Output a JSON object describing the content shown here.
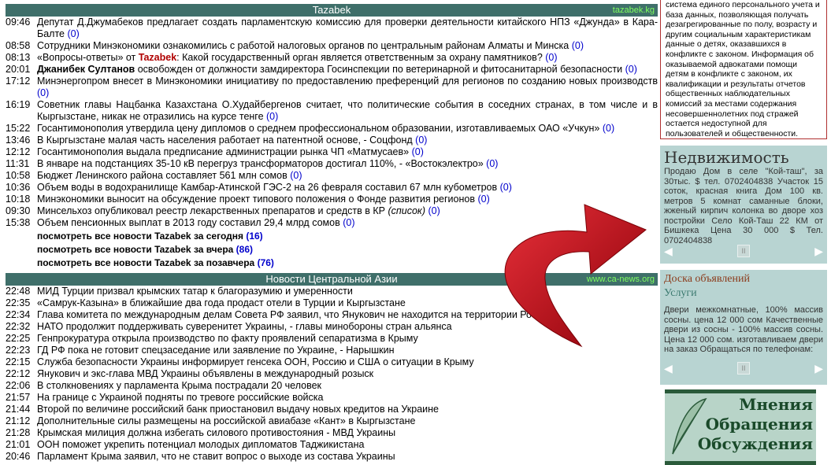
{
  "tazabek": {
    "title": "Tazabek",
    "site": "tazabek.kg",
    "news": [
      {
        "time": "09:46",
        "text": "Депутат Д.Джумабеков предлагает создать парламентскую комиссию для проверки деятельности китайского НПЗ «Джунда» в Кара-Балте",
        "count": "(0)"
      },
      {
        "time": "08:58",
        "text": "Сотрудники Минэкономики ознакомились с работой налоговых органов по центральным районам Алматы и Минска",
        "count": "(0)"
      },
      {
        "time": "08:13",
        "text": "«Вопросы-ответы» от ",
        "brand": "Tazabek",
        "after": ": Какой государственный орган является ответственным за охрану памятников?",
        "count": "(0)"
      },
      {
        "time": "20:01",
        "bold": "Джанибек Султанов",
        "text": " освобожден от должности замдиректора Госинспекции по ветеринарной и фитосанитарной безопасности",
        "count": "(0)"
      },
      {
        "time": "17:12",
        "text": "Минэнергопром внесет в Минэкономики инициативу по предоставлению преференций для регионов по созданию новых производств",
        "count": "(0)"
      },
      {
        "time": "16:19",
        "text": "Советник главы Нацбанка Казахстана О.Худайбергенов считает, что политические события в соседних странах, в том числе и в Кыргызстане, никак не отразились на курсе тенге",
        "count": "(0)"
      },
      {
        "time": "15:22",
        "text": "Госантимонополия утвердила цену дипломов о среднем профессиональном образовании, изготавливаемых ОАО «Учкун»",
        "count": "(0)"
      },
      {
        "time": "13:46",
        "text": "В Кыргызстане малая часть населения работает на патентной основе, - Соцфонд",
        "count": "(0)"
      },
      {
        "time": "12:12",
        "text": "Госантимонополия выдала предписание администрации рынка ЧП «Матмусаев»",
        "count": "(0)"
      },
      {
        "time": "11:31",
        "text": "В январе на подстанциях 35-10 кВ перегруз трансформаторов достигал 110%, - «Востокэлектро»",
        "count": "(0)"
      },
      {
        "time": "10:58",
        "text": "Бюджет Ленинского района составляет 561 млн сомов",
        "count": "(0)"
      },
      {
        "time": "10:36",
        "text": "Объем воды в водохранилище Камбар-Атинской ГЭС-2 на 26 февраля составил 67 млн кубометров",
        "count": "(0)"
      },
      {
        "time": "10:18",
        "text": "Минэкономики выносит на обсуждение проект типового положения о Фонде развития регионов",
        "count": "(0)"
      },
      {
        "time": "09:30",
        "text": "Минсельхоз опубликовал реестр лекарственных препаратов и средств в КР ",
        "italic": "(список)",
        "count": "(0)"
      },
      {
        "time": "15:38",
        "text": "Объем пенсионных выплат в 2013 году составил 29,4 млрд сомов",
        "count": "(0)"
      }
    ],
    "more": [
      {
        "label": "посмотреть все новости Tazabek за сегодня",
        "count": "(16)"
      },
      {
        "label": "посмотреть все новости Tazabek за вчера",
        "count": "(86)"
      },
      {
        "label": "посмотреть все новости Tazabek за позавчера",
        "count": "(76)"
      }
    ]
  },
  "ca_news": {
    "title": "Новости Центральной Азии",
    "site": "www.ca-news.org",
    "news": [
      {
        "time": "22:48",
        "text": "МИД Турции призвал крымских татар к благоразумию и умеренности"
      },
      {
        "time": "22:35",
        "text": "«Самрук-Казына» в ближайшие два года продаст отели в Турции и Кыргызстане"
      },
      {
        "time": "22:34",
        "text": "Глава комитета по международным делам Совета РФ заявил, что Янукович не находится на территории России"
      },
      {
        "time": "22:32",
        "text": "НАТО продолжит поддерживать суверенитет Украины, - главы минобороны стран альянса"
      },
      {
        "time": "22:25",
        "text": "Генпрокуратура открыла производство по факту проявлений сепаратизма в Крыму"
      },
      {
        "time": "22:23",
        "text": "ГД РФ пока не готовит спецзаседание или заявление по Украине, - Нарышкин"
      },
      {
        "time": "22:15",
        "text": "Служба безопасности Украины информирует генсека ООН, Россию и США о ситуации в Крыму"
      },
      {
        "time": "22:12",
        "text": "Янукович и экс-глава МВД Украины объявлены в международный розыск"
      },
      {
        "time": "22:06",
        "text": "В столкновениях у парламента Крыма пострадали 20 человек"
      },
      {
        "time": "21:57",
        "text": "На границе с Украиной подняты по тревоге российские войска"
      },
      {
        "time": "21:44",
        "text": "Второй по величине российский банк приостановил выдачу новых кредитов на Украине"
      },
      {
        "time": "21:12",
        "text": "Дополнительные силы размещены на российской авиабазе «Кант» в Кыргызстане"
      },
      {
        "time": "21:28",
        "text": "Крымская милиция должна избегать силового противостояния - МВД Украины"
      },
      {
        "time": "21:01",
        "text": "ООН поможет укрепить потенциал молодых дипломатов Таджикистана"
      },
      {
        "time": "20:46",
        "text": "Парламент Крыма заявил, что не ставит вопрос о выходе из состава Украины"
      }
    ]
  },
  "right_box_text": "система единого персонального учета и база данных, позволяющая получать дезагрегированные по полу, возрасту и другим социальным характеристикам данные о детях, оказавшихся в конфликте с законом. Информация об оказываемой адвокатами помощи детям в конфликте с законом, их квалификации и результаты отчетов общественных наблюдательных комиссий за местами содержания несовершеннолетних под стражей остается недоступной для пользователей и общественности.",
  "realty": {
    "title": "Недвижимость",
    "text": "Продаю Дом в селе \"Кой-таш\", за 30тыс. $ тел. 0702404838 Участок 15 соток, красная книга Дом 100 кв. метров 5 комнат саманные блоки, жженый кирпич колонка во дворе хоз постройки Село Кой-Таш 22 КМ от Бишкека Цена 30 000 $ Тел. 0702404838"
  },
  "ads": {
    "title": "Доска объявлений",
    "subtitle": "Услуги",
    "text": "Двери межкомнатные, 100% массив сосны. цена 12 000 сом Качественные двери из сосны - 100% массив сосны. Цена 12 000 сом. изготавливаем двери на заказ Обращаться по телефонам:"
  },
  "opinions": {
    "lines": [
      "Мнения",
      "Обращения",
      "Обсуждения"
    ]
  },
  "controls": {
    "prev": "◀",
    "pause": "II",
    "next": "▶"
  },
  "colors": {
    "header_bg": "#3f6f6a",
    "panel_bg": "#b8d4d2",
    "arrow": "#c8101a",
    "link": "#0000cc"
  }
}
